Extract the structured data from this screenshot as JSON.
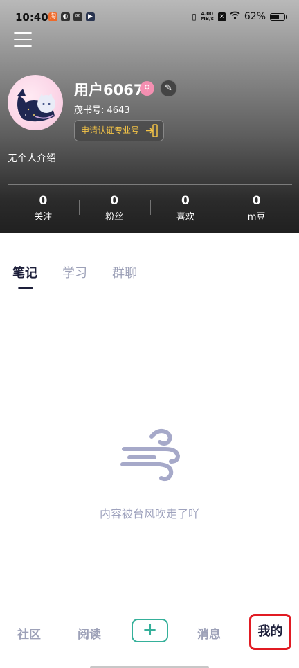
{
  "status_bar": {
    "time": "10:40",
    "net_speed_value": "4.00",
    "net_speed_unit": "MB/s",
    "battery": "62%",
    "battery_level": 0.62
  },
  "profile": {
    "username": "用户6067",
    "maoshu_id": "茂书号: 4643",
    "certify_button": "申请认证专业号",
    "bio": "无个人介绍"
  },
  "stats": [
    {
      "value": "0",
      "label": "关注"
    },
    {
      "value": "0",
      "label": "粉丝"
    },
    {
      "value": "0",
      "label": "喜欢"
    },
    {
      "value": "0",
      "label": "m豆"
    }
  ],
  "tabs": [
    {
      "label": "笔记",
      "active": true
    },
    {
      "label": "学习",
      "active": false
    },
    {
      "label": "群聊",
      "active": false
    }
  ],
  "empty_state": {
    "icon": "wind-icon",
    "message": "内容被台风吹走了吖"
  },
  "bottom_nav": {
    "community": "社区",
    "read": "阅读",
    "add": "+",
    "messages": "消息",
    "mine": "我的"
  },
  "colors": {
    "accent_green": "#35b09a",
    "highlight_red": "#e11b23",
    "certify_gold": "#f4c447",
    "muted_text": "#9da1b8"
  }
}
